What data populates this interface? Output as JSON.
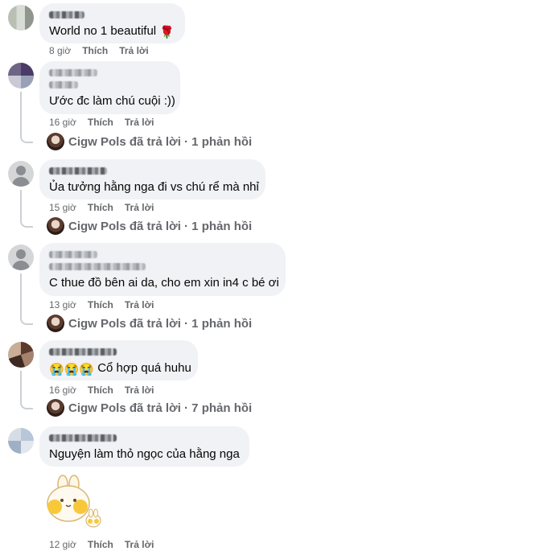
{
  "comments": [
    {
      "text": "World no 1 beautiful",
      "emoji": "🌹",
      "time": "8 giờ",
      "like": "Thích",
      "reply": "Trả lời"
    },
    {
      "text": "Ước đc làm chú cuội :))",
      "time": "16 giờ",
      "like": "Thích",
      "reply": "Trả lời",
      "replies_summary": "Cigw Pols đã trả lời · 1 phản hồi"
    },
    {
      "text": "Ủa tưởng hằng nga đi vs chú rể mà nhỉ",
      "time": "15 giờ",
      "like": "Thích",
      "reply": "Trả lời",
      "replies_summary": "Cigw Pols đã trả lời · 1 phản hồi"
    },
    {
      "text": "C thue đồ bên ai da, cho em xin in4 c bé ơi",
      "time": "13 giờ",
      "like": "Thích",
      "reply": "Trả lời",
      "replies_summary": "Cigw Pols đã trả lời · 1 phản hồi"
    },
    {
      "emoji": "😭😭😭",
      "text": "Cổ hợp quá huhu",
      "time": "16 giờ",
      "like": "Thích",
      "reply": "Trả lời",
      "replies_summary": "Cigw Pols đã trả lời · 7 phản hồi"
    },
    {
      "text": "Nguyện làm thỏ ngọc của hằng nga",
      "time": "12 giờ",
      "like": "Thích",
      "reply": "Trả lời",
      "sticker": "bunny-sticker"
    }
  ]
}
